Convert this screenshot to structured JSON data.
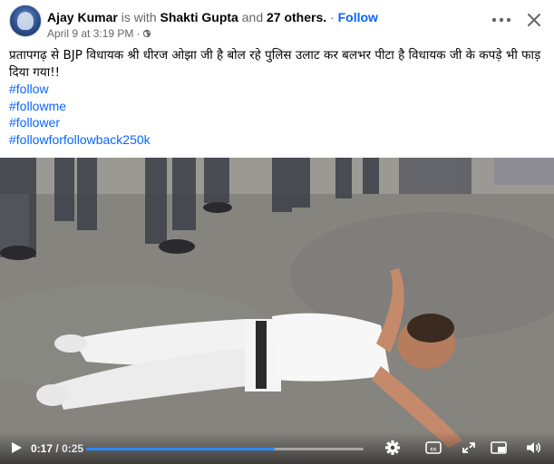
{
  "post": {
    "author": "Ajay Kumar",
    "with_text": "is with",
    "tagged": "Shakti Gupta",
    "and_text": "and",
    "others": "27 others.",
    "separator": "·",
    "follow": "Follow",
    "timestamp": "April 9 at 3:19 PM",
    "privacy_icon": "globe-icon",
    "body": "प्रतापगढ़ से BJP विधायक श्री धीरज ओझा जी है बोल रहे पुलिस उलाट कर बलभर पीटा है विधायक जी के कपड़े भी फाड़ दिया गया!!",
    "hashtags": [
      "#follow",
      "#followme",
      "#follower",
      "#followforfollowback250k"
    ]
  },
  "header_actions": {
    "more_icon": "more-horizontal-icon",
    "close_icon": "close-icon"
  },
  "video": {
    "current_time": "0:17",
    "time_separator": "/",
    "duration": "0:25",
    "progress": 0.68,
    "accent_color": "#2d88ff",
    "icons": [
      "play-icon",
      "settings-gear-icon",
      "captions-icon",
      "fullscreen-expand-icon",
      "picture-in-picture-icon",
      "volume-icon"
    ]
  }
}
